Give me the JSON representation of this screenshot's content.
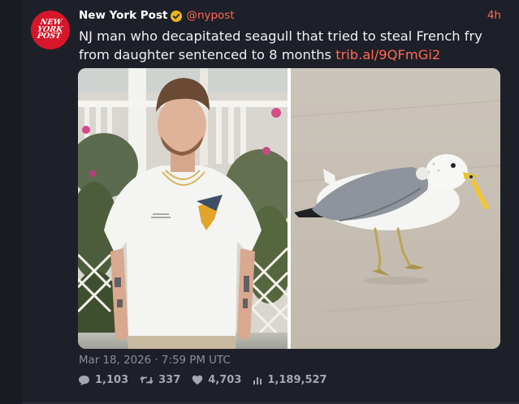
{
  "post": {
    "author": {
      "display_name": "New York Post",
      "handle": "@nypost",
      "avatar_text": [
        "NEW",
        "YORK",
        "POST"
      ],
      "verified": true
    },
    "relative_time": "4h",
    "text": "NJ man who decapitated seagull that tried to steal French fry from daughter sentenced to 8 months ",
    "link_text": "trib.al/9QFmGi2",
    "media": {
      "left_image": "photo-man-in-white-tshirt",
      "right_image": "photo-seagull-with-french-fry"
    },
    "date_time": "Mar 18, 2026 · 7:59 PM UTC",
    "stats": {
      "replies": "1,103",
      "reposts": "337",
      "likes": "4,703",
      "views": "1,189,527"
    }
  },
  "colors": {
    "background": "#191b22",
    "card": "#1e2029",
    "accent": "#ff6a50",
    "brand_red": "#d7162a",
    "text": "#eef0f4",
    "muted": "#8b8e99"
  },
  "icons": {
    "verified": "verified-badge-icon",
    "reply": "comment-icon",
    "repost": "retweet-icon",
    "like": "heart-icon",
    "views": "bar-chart-icon"
  }
}
